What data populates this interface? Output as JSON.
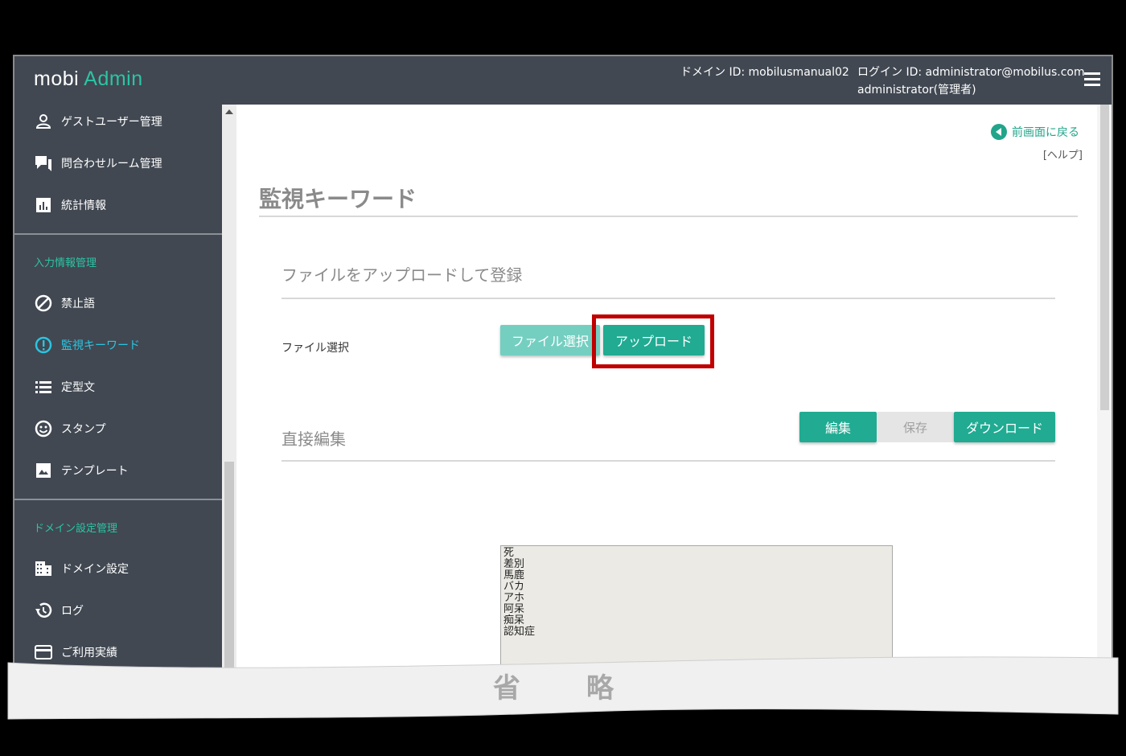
{
  "app": {
    "logo_left": "mobi",
    "logo_right": "Admin"
  },
  "header": {
    "domain_id": "ドメイン ID: mobilusmanual02",
    "login_id": "ログイン ID: administrator@mobilus.com",
    "user_role": "administrator(管理者)",
    "menu_icon": "hamburger-icon"
  },
  "sidebar": {
    "items_top": [
      {
        "label": "ゲストユーザー管理",
        "icon": "person-icon"
      },
      {
        "label": "問合わせルーム管理",
        "icon": "chat-icon"
      },
      {
        "label": "統計情報",
        "icon": "chart-icon"
      }
    ],
    "section_input": "入力情報管理",
    "items_input": [
      {
        "label": "禁止語",
        "icon": "block-icon"
      },
      {
        "label": "監視キーワード",
        "icon": "alert-icon"
      },
      {
        "label": "定型文",
        "icon": "list-icon"
      },
      {
        "label": "スタンプ",
        "icon": "smile-icon"
      },
      {
        "label": "テンプレート",
        "icon": "image-icon"
      }
    ],
    "section_domain": "ドメイン設定管理",
    "items_domain": [
      {
        "label": "ドメイン設定",
        "icon": "building-icon"
      },
      {
        "label": "ログ",
        "icon": "history-icon"
      },
      {
        "label": "ご利用実績",
        "icon": "card-icon"
      }
    ]
  },
  "main": {
    "back_link": "前画面に戻る",
    "help_link": "[ヘルプ]",
    "page_title": "監視キーワード",
    "upload_section_title": "ファイルをアップロードして登録",
    "file_label": "ファイル選択",
    "file_button": "ファイル選択",
    "upload_button": "アップロード",
    "direct_edit_title": "直接編集",
    "edit_button": "編集",
    "save_button": "保存",
    "download_button": "ダウンロード",
    "keywords": [
      "死",
      "差別",
      "馬鹿",
      "バカ",
      "アホ",
      "阿呆",
      "痴呆",
      "認知症"
    ]
  },
  "omission_label": "省　略",
  "colors": {
    "header_bg": "#414852",
    "accent": "#20ab92",
    "active_sidebar": "#2bc4e0",
    "highlight": "#c00000"
  }
}
